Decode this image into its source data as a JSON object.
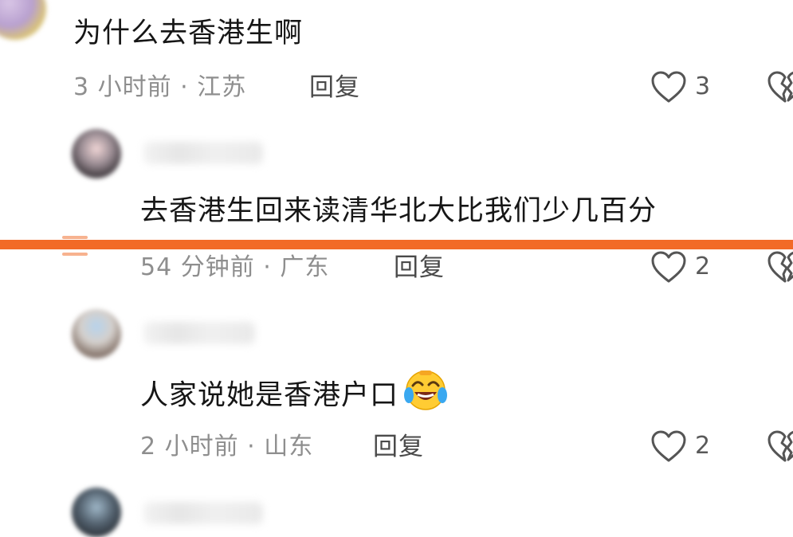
{
  "comments": [
    {
      "text": "为什么去香港生啊",
      "time": "3 小时前",
      "location": "江苏",
      "reply_label": "回复",
      "likes": "3"
    },
    {
      "text": "去香港生回来读清华北大比我们少几百分",
      "time": "54 分钟前",
      "location": "广东",
      "reply_label": "回复",
      "likes": "2"
    },
    {
      "text": "人家说她是香港户口",
      "emoji": "laughing-crying-emoji",
      "time": "2 小时前",
      "location": "山东",
      "reply_label": "回复",
      "likes": "2"
    }
  ],
  "separator": "·",
  "colors": {
    "highlight_bar": "#f26a27",
    "meta_text": "#8e8e8e",
    "body_text": "#161616"
  },
  "icons": {
    "like": "heart-outline-icon",
    "dislike": "broken-heart-icon"
  }
}
